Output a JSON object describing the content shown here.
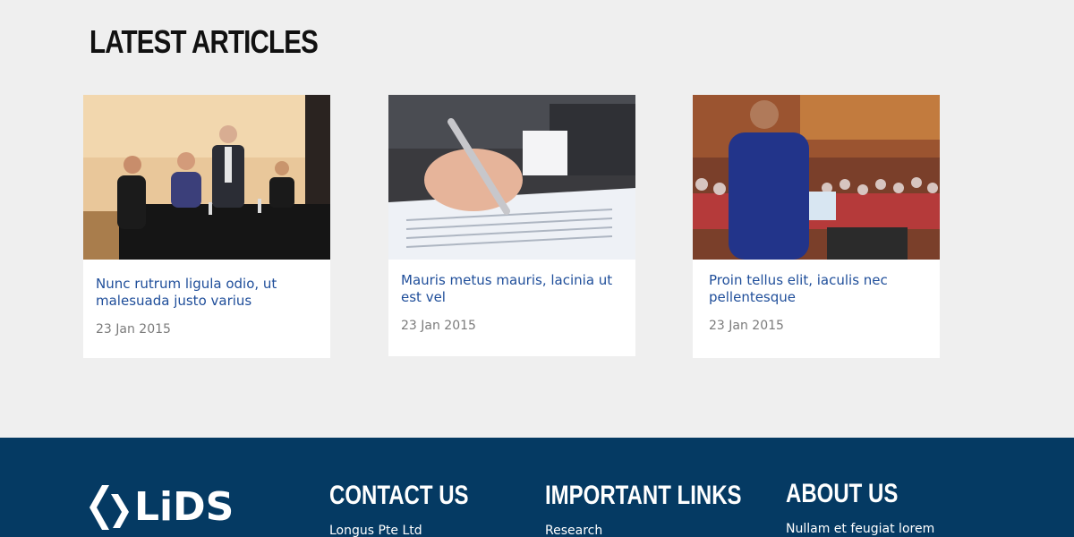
{
  "section": {
    "title": "LATEST ARTICLES"
  },
  "articles": [
    {
      "title": "Nunc rutrum ligula odio, ut malesuada justo varius",
      "date": "23 Jan 2015",
      "image": "conference-panel-photo"
    },
    {
      "title": "Mauris metus mauris, lacinia ut est vel",
      "date": "23 Jan 2015",
      "image": "signing-document-photo"
    },
    {
      "title": "Proin tellus elit, iaculis nec pellentesque",
      "date": "23 Jan 2015",
      "image": "presentation-audience-photo"
    }
  ],
  "footer": {
    "logo_text": "LiDS",
    "contact": {
      "heading": "CONTACT US",
      "line1": "Longus Pte Ltd"
    },
    "links": {
      "heading": "IMPORTANT LINKS",
      "item1": "Research"
    },
    "about": {
      "heading": "ABOUT US",
      "line1": "Nullam et feugiat lorem"
    }
  },
  "colors": {
    "background": "#efefef",
    "link": "#1f4e9a",
    "date": "#7b7b7b",
    "footer": "#053a63"
  }
}
